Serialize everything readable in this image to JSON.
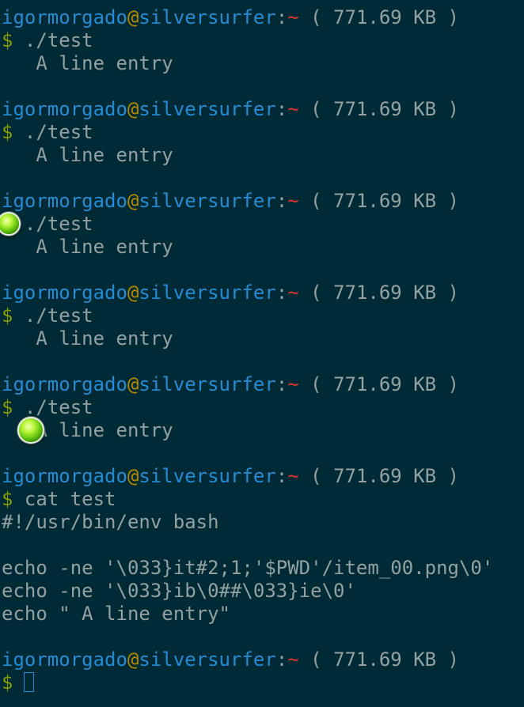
{
  "terminal": {
    "user": "igormorgado",
    "at": "@",
    "host": "silversurfer",
    "colon": ":",
    "tilde": "~",
    "size": " ( 771.69 KB )",
    "prompt_symbol": "$",
    "run_cmd": "./test",
    "output_line": "   A line entry",
    "cat_cmd": "cat test",
    "file_lines": [
      "#!/usr/bin/env bash",
      "",
      "echo -ne '\\033}it#2;1;'$PWD'/item_00.png\\0'",
      "echo -ne '\\033}ib\\0##\\033}ie\\0'",
      "echo \" A line entry\""
    ]
  },
  "colors": {
    "background": "#002b36",
    "foreground": "#93a1a1",
    "user_host": "#268bd2",
    "at_sign": "#b58900",
    "tilde": "#dc322f",
    "prompt": "#859900"
  },
  "icons": [
    "green-orb-icon"
  ]
}
